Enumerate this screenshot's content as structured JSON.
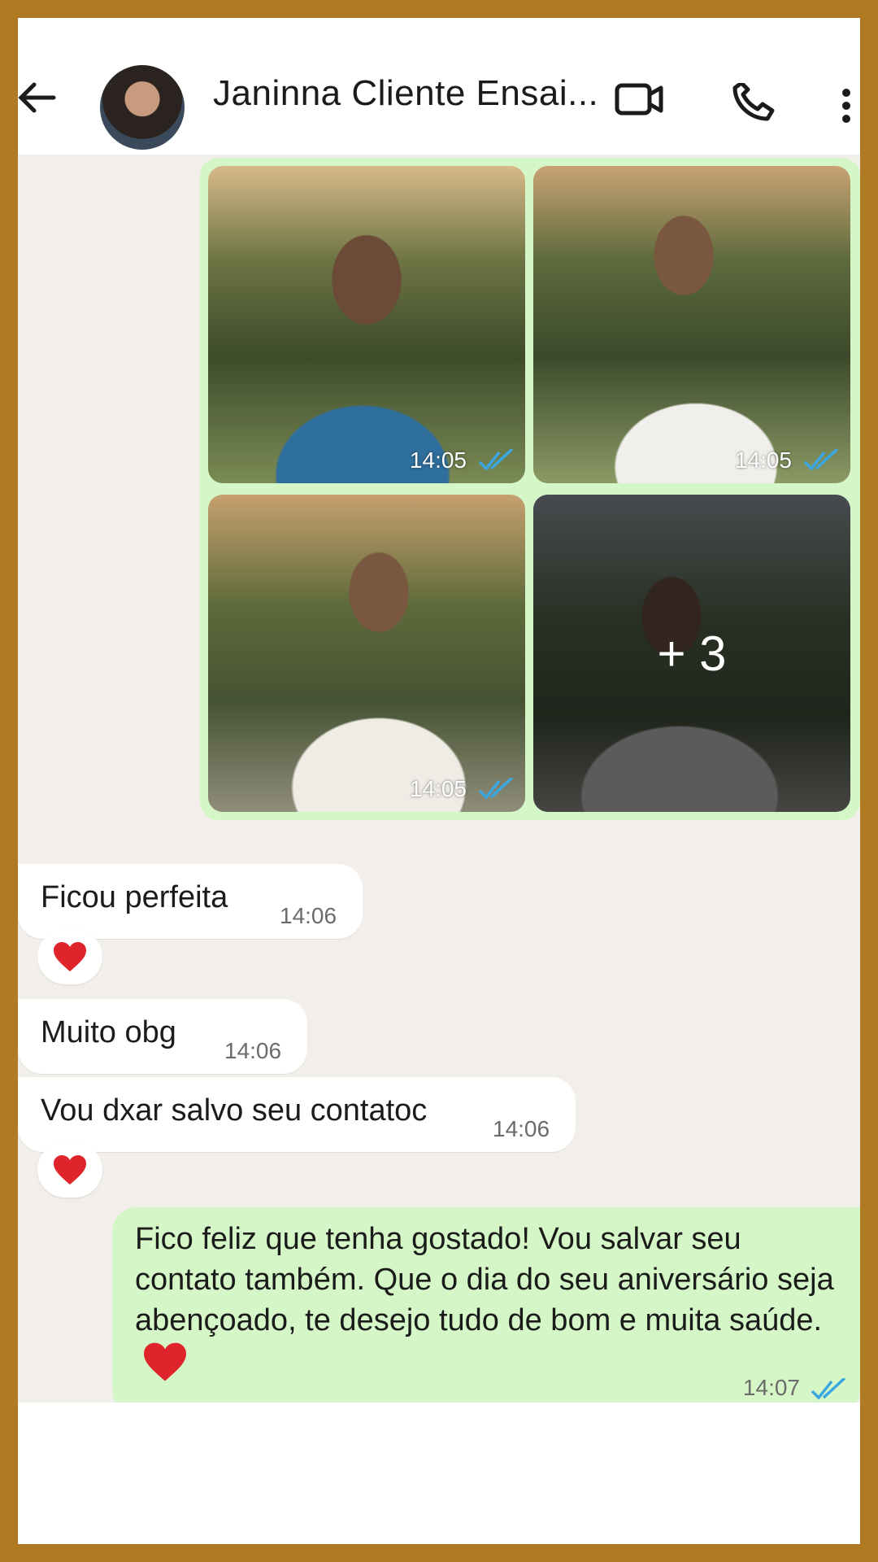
{
  "header": {
    "contact_name": "Janinna Cliente Ensai...",
    "icons": [
      "back-arrow-icon",
      "avatar",
      "video-call-icon",
      "phone-call-icon",
      "more-vert-icon"
    ]
  },
  "media_group": {
    "photos": [
      {
        "time": "14:05",
        "status": "read"
      },
      {
        "time": "14:05",
        "status": "read"
      },
      {
        "time": "14:05",
        "status": "read"
      },
      {
        "more_label": "+ 3"
      }
    ]
  },
  "messages": [
    {
      "direction": "incoming",
      "text": "Ficou perfeita",
      "time": "14:06",
      "reaction": "❤️"
    },
    {
      "direction": "incoming",
      "text": "Muito obg",
      "time": "14:06"
    },
    {
      "direction": "incoming",
      "text": "Vou dxar salvo seu contatoc",
      "time": "14:06",
      "reaction": "❤️"
    },
    {
      "direction": "outgoing",
      "text": "Fico feliz que tenha gostado!  Vou salvar seu contato também. Que o dia do seu aniversário seja abençoado, te desejo tudo de bom e muita saúde.",
      "time": "14:07",
      "status": "read"
    }
  ],
  "colors": {
    "frame": "#b07a22",
    "chat_background": "#f2efea",
    "outgoing_bubble": "#d5f7c7",
    "incoming_bubble": "#ffffff",
    "read_ticks": "#3ba7e0",
    "heart": "#e0242b"
  }
}
